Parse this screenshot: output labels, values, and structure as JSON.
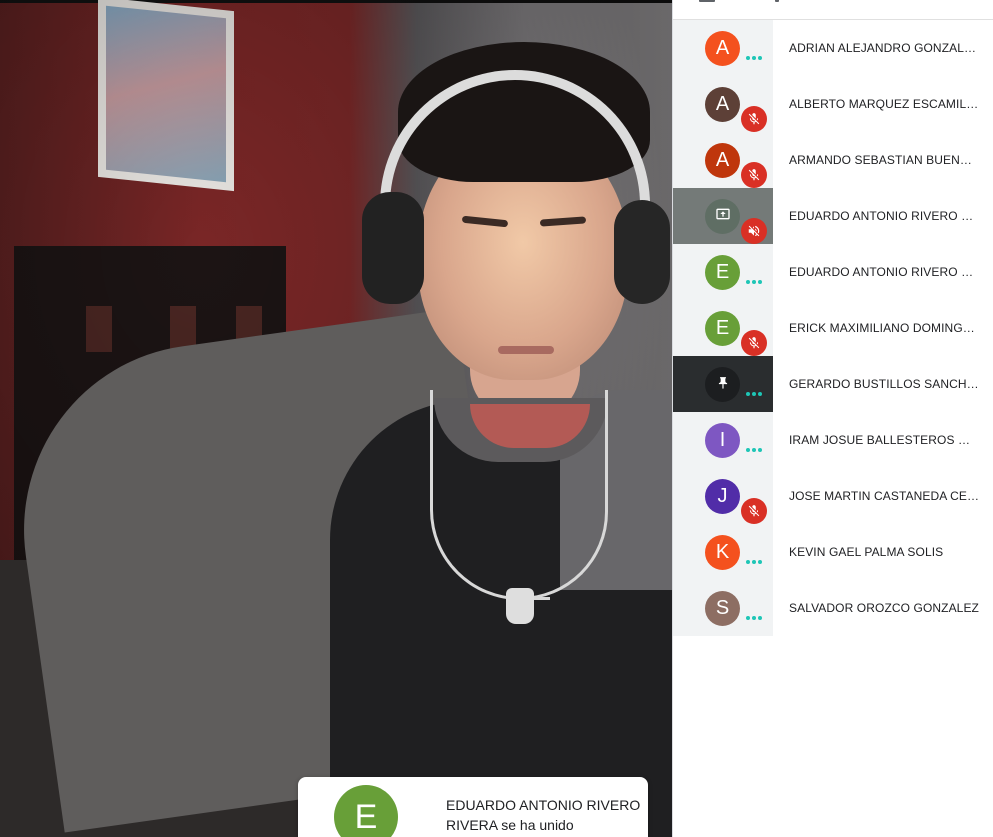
{
  "participants": [
    {
      "initial": "A",
      "name": "ADRIAN ALEJANDRO GONZALEZ",
      "color": "#f4511e",
      "status": "speaking-dots",
      "tile": "normal"
    },
    {
      "initial": "A",
      "name": "ALBERTO MARQUEZ ESCAMILLA",
      "color": "#5d4037",
      "status": "muted",
      "tile": "normal"
    },
    {
      "initial": "A",
      "name": "ARMANDO SEBASTIAN BUENROSTRO",
      "color": "#bf360c",
      "status": "muted",
      "tile": "normal"
    },
    {
      "initial": "",
      "name": "EDUARDO ANTONIO RIVERO RIVERA",
      "color": "#5f6e64",
      "status": "muted-sound",
      "tile": "presenting",
      "icon": "present-screen-icon"
    },
    {
      "initial": "E",
      "name": "EDUARDO ANTONIO RIVERO RIVERA",
      "color": "#689f38",
      "status": "speaking-dots",
      "tile": "normal"
    },
    {
      "initial": "E",
      "name": "ERICK MAXIMILIANO DOMINGUEZ",
      "color": "#689f38",
      "status": "muted",
      "tile": "normal"
    },
    {
      "initial": "",
      "name": "GERARDO BUSTILLOS SANCHEZ",
      "color": "#1c1e20",
      "status": "speaking-dots",
      "tile": "pinned",
      "icon": "pin-icon"
    },
    {
      "initial": "I",
      "name": "IRAM JOSUE BALLESTEROS MARTINEZ",
      "color": "#7e57c2",
      "status": "speaking-dots",
      "tile": "normal"
    },
    {
      "initial": "J",
      "name": "JOSE MARTIN CASTANEDA CERVANTES",
      "color": "#512da8",
      "status": "muted",
      "tile": "normal"
    },
    {
      "initial": "K",
      "name": "KEVIN GAEL PALMA SOLIS",
      "color": "#f4511e",
      "status": "speaking-dots",
      "tile": "normal"
    },
    {
      "initial": "S",
      "name": "SALVADOR OROZCO GONZALEZ",
      "color": "#8d6e63",
      "status": "speaking-dots",
      "tile": "normal"
    }
  ],
  "toast": {
    "initial": "E",
    "avatar_color": "#689f38",
    "message": "EDUARDO ANTONIO RIVERO RIVERA se ha unido"
  },
  "colors": {
    "muted_red": "#d93025",
    "dots_teal": "#1ec6b6",
    "panel_bg": "#ffffff",
    "tile_bg": "#f1f3f4"
  }
}
